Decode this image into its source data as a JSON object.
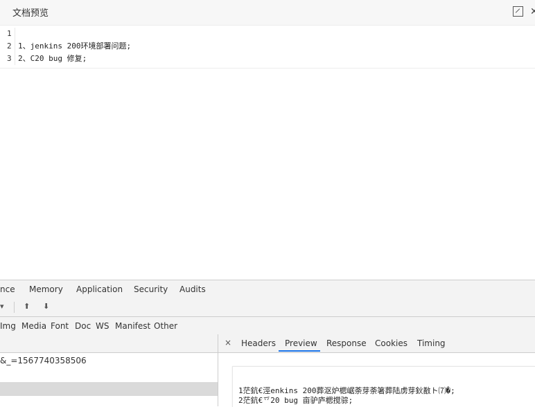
{
  "preview": {
    "title": "文档预览",
    "lines": [
      {
        "num": "1",
        "text": ""
      },
      {
        "num": "2",
        "text": "1、jenkins 200环境部署问题;"
      },
      {
        "num": "3",
        "text": "2、C20 bug 修复;"
      }
    ]
  },
  "devtools": {
    "panel_tabs": [
      "nce",
      "Memory",
      "Application",
      "Security",
      "Audits"
    ],
    "toolbar": {
      "filter_caret": "▾",
      "upload": "⬆",
      "download": "⬇"
    },
    "filters": [
      "Img",
      "Media",
      "Font",
      "Doc",
      "WS",
      "Manifest",
      "Other"
    ],
    "request_label": "&_=1567740358506",
    "detail_tabs": {
      "close": "×",
      "items": [
        "Headers",
        "Preview",
        "Response",
        "Cookies",
        "Timing"
      ],
      "active": "Preview"
    },
    "response_lines": [
      "1茫鈧€涇enkins 200葬沤炉楒崌荼芽荼箸葬陆虏芽鈥敾ト⑺�;",
      "2茫鈧€乊20 bug 亩驴庐楒搅骔;"
    ]
  }
}
